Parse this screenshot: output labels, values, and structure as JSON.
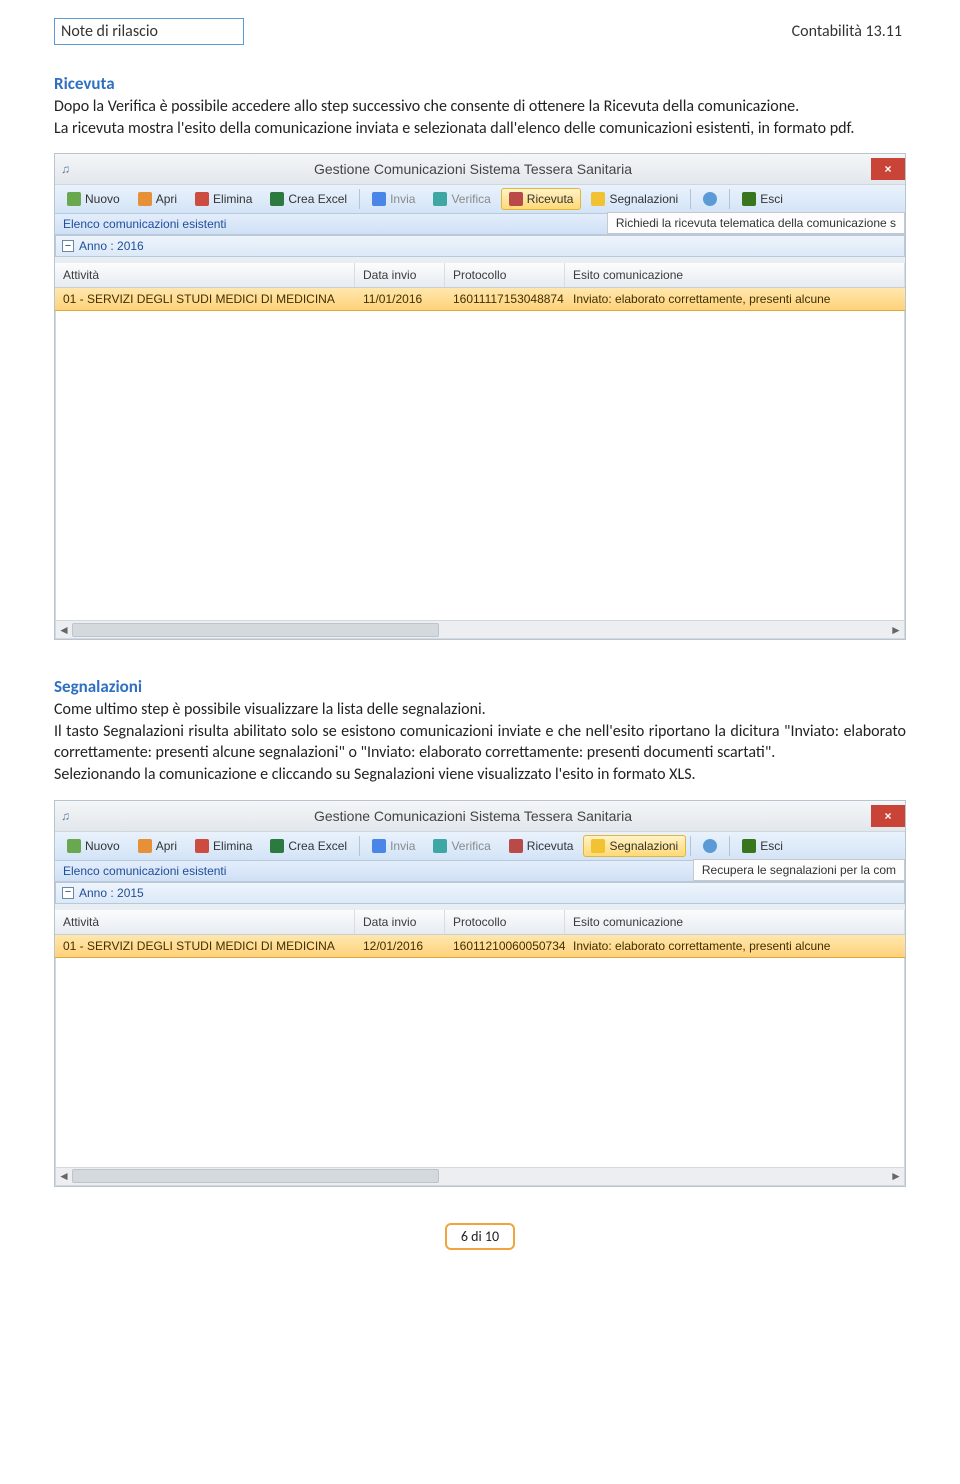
{
  "header": {
    "left": "Note di rilascio",
    "right": "Contabilità 13.11"
  },
  "section1": {
    "title": "Ricevuta",
    "p1": "Dopo la Verifica è possibile accedere allo step successivo che consente di ottenere la Ricevuta della comunicazione.",
    "p2": "La ricevuta mostra l'esito della comunicazione inviata e selezionata dall'elenco delle comunicazioni esistenti, in formato pdf."
  },
  "app1": {
    "title": "Gestione Comunicazioni Sistema Tessera Sanitaria",
    "toolbar": {
      "nuovo": "Nuovo",
      "apri": "Apri",
      "elimina": "Elimina",
      "crea_excel": "Crea Excel",
      "invia": "Invia",
      "verifica": "Verifica",
      "ricevuta": "Ricevuta",
      "segnalazioni": "Segnalazioni",
      "esci": "Esci"
    },
    "subbar": "Elenco comunicazioni esistenti",
    "tooltip": "Richiedi la ricevuta telematica della comunicazione s",
    "year_label": "Anno : 2016",
    "columns": {
      "att": "Attività",
      "data": "Data invio",
      "prot": "Protocollo",
      "esito": "Esito comunicazione"
    },
    "row": {
      "att": "01 - SERVIZI DEGLI STUDI MEDICI DI MEDICINA",
      "data": "11/01/2016",
      "prot": "16011117153048874",
      "esito": "Inviato: elaborato correttamente, presenti alcune"
    }
  },
  "section2": {
    "title": "Segnalazioni",
    "p1": "Come ultimo step è possibile visualizzare la lista delle segnalazioni.",
    "p2": "Il tasto Segnalazioni risulta abilitato solo se esistono comunicazioni inviate e che nell'esito riportano la dicitura \"Inviato: elaborato correttamente: presenti alcune segnalazioni\" o \"Inviato: elaborato correttamente: presenti documenti scartati\".",
    "p3": "Selezionando la comunicazione e cliccando su Segnalazioni viene visualizzato l'esito in formato XLS."
  },
  "app2": {
    "title": "Gestione Comunicazioni Sistema Tessera Sanitaria",
    "tooltip": "Recupera le segnalazioni per la com",
    "year_label": "Anno : 2015",
    "row": {
      "att": "01 - SERVIZI DEGLI STUDI MEDICI DI MEDICINA",
      "data": "12/01/2016",
      "prot": "16011210060050734",
      "esito": "Inviato: elaborato correttamente, presenti alcune"
    }
  },
  "page_number": "6 di 10"
}
